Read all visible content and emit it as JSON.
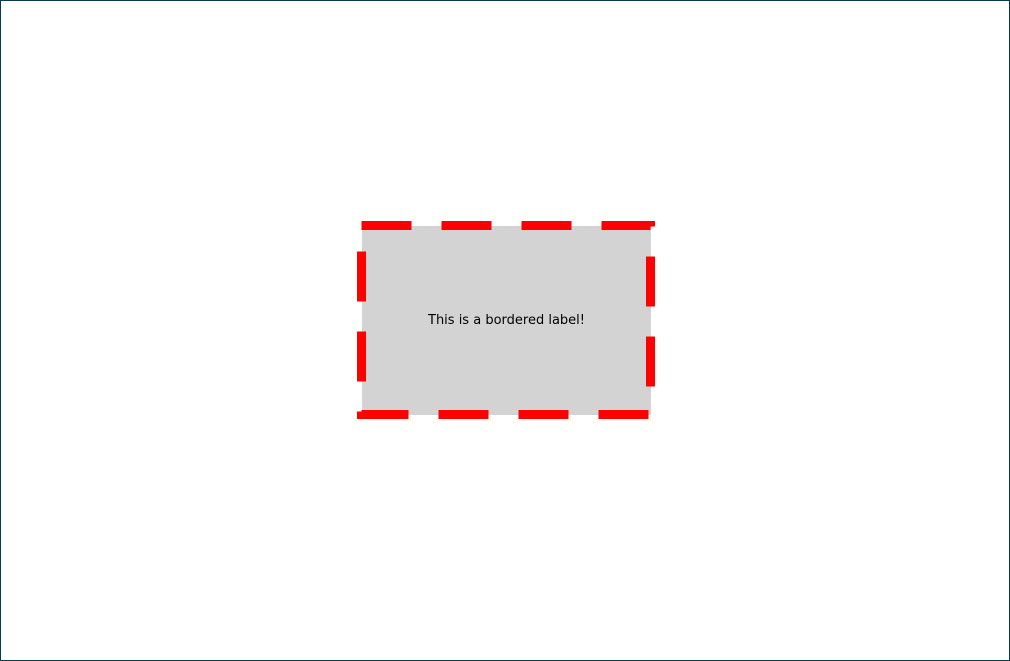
{
  "label": {
    "text": "This is a bordered label!",
    "background_color": "#d3d3d3",
    "border_color": "#ff0000",
    "border_style": "dashed"
  }
}
